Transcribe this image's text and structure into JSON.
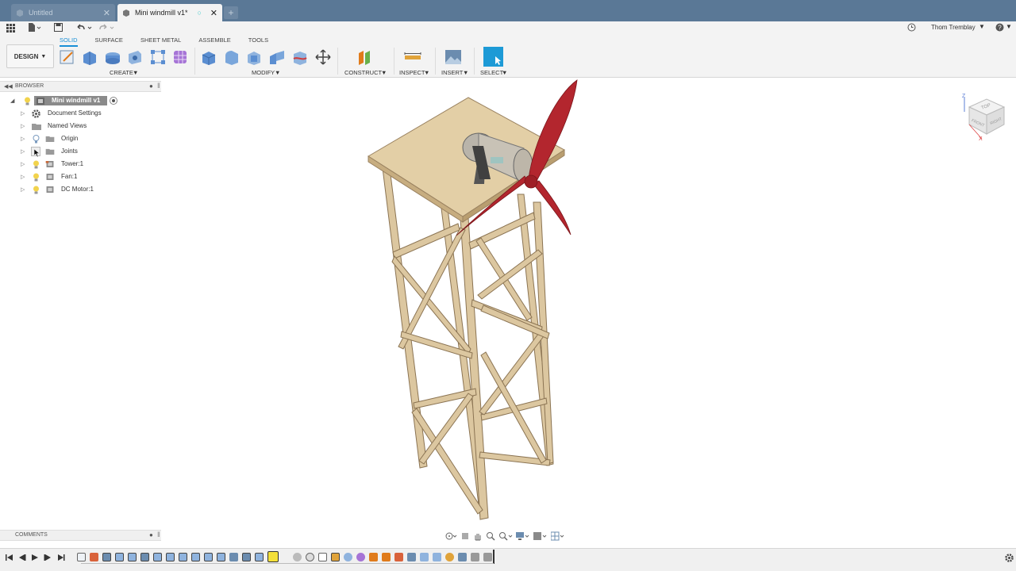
{
  "tabs": [
    {
      "label": "Untitled"
    },
    {
      "label": "Mini windmill v1*"
    }
  ],
  "user": {
    "name": "Thom Tremblay"
  },
  "workspace": {
    "label": "DESIGN"
  },
  "workspace_tabs": [
    {
      "label": "SOLID"
    },
    {
      "label": "SURFACE"
    },
    {
      "label": "SHEET METAL"
    },
    {
      "label": "ASSEMBLE"
    },
    {
      "label": "TOOLS"
    }
  ],
  "groups": {
    "create": "CREATE",
    "modify": "MODIFY",
    "construct": "CONSTRUCT",
    "inspect": "INSPECT",
    "insert": "INSERT",
    "select": "SELECT"
  },
  "browser": {
    "title": "BROWSER",
    "root": "Mini windmill v1",
    "items": [
      {
        "label": "Document Settings",
        "icon": "gear-icon"
      },
      {
        "label": "Named Views",
        "icon": "folder-icon"
      },
      {
        "label": "Origin",
        "icon": "folder-icon"
      },
      {
        "label": "Joints",
        "icon": "folder-icon"
      },
      {
        "label": "Tower:1",
        "icon": "component-icon"
      },
      {
        "label": "Fan:1",
        "icon": "component-icon"
      },
      {
        "label": "DC Motor:1",
        "icon": "component-icon"
      }
    ]
  },
  "comments": {
    "title": "COMMENTS"
  },
  "viewcube": {
    "top": "TOP",
    "front": "FRONT",
    "right": "RIGHT"
  },
  "colors": {
    "titlebar": "#5a7896",
    "accent": "#1a8fd6",
    "wood": "#d9c29a",
    "blade": "#b3262e"
  }
}
